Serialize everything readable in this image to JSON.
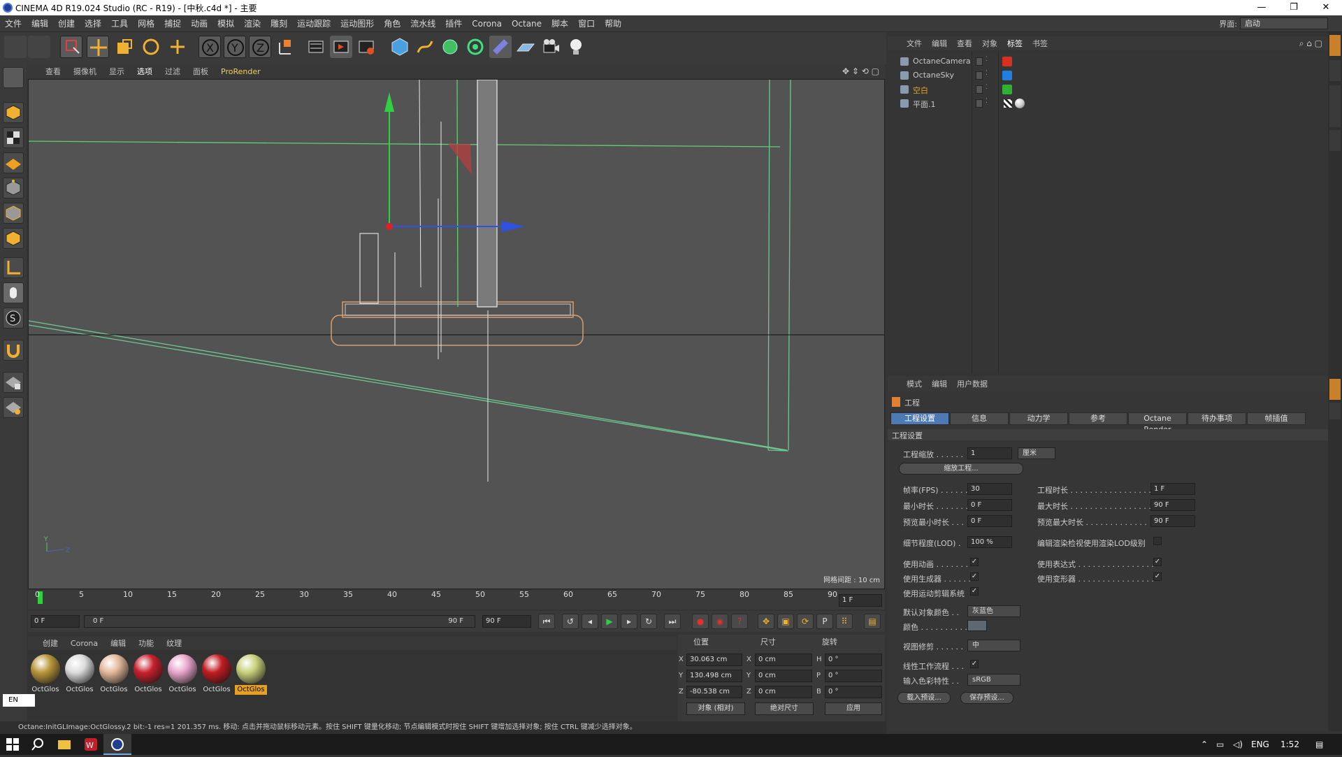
{
  "window": {
    "title": "CINEMA 4D R19.024 Studio (RC - R19) - [中秋.c4d *] - 主要"
  },
  "menu": [
    "文件",
    "编辑",
    "创建",
    "选择",
    "工具",
    "网格",
    "捕捉",
    "动画",
    "模拟",
    "渲染",
    "雕刻",
    "运动跟踪",
    "运动图形",
    "角色",
    "流水线",
    "插件",
    "Corona",
    "Octane",
    "脚本",
    "窗口",
    "帮助"
  ],
  "layout": {
    "label": "界面:",
    "value": "启动"
  },
  "viewport": {
    "menu": [
      "查看",
      "摄像机",
      "显示",
      "选项",
      "过滤",
      "面板",
      "ProRender"
    ],
    "grid_label": "网格间距 : 10 cm",
    "axis_y": "Y",
    "axis_z": "Z"
  },
  "timeline": {
    "ticks": [
      "0",
      "5",
      "10",
      "15",
      "20",
      "25",
      "30",
      "35",
      "40",
      "45",
      "50",
      "55",
      "60",
      "65",
      "70",
      "75",
      "80",
      "85",
      "90"
    ],
    "current_frame": "1 F",
    "start_field": "0 F",
    "range_start": "0 F",
    "range_end": "90 F",
    "end_field": "90 F"
  },
  "materials": {
    "menu": [
      "创建",
      "Corona",
      "编辑",
      "功能",
      "纹理"
    ],
    "items": [
      {
        "label": "OctGlos",
        "color": "#b8963a"
      },
      {
        "label": "OctGlos",
        "color": "#dcdcdc"
      },
      {
        "label": "OctGlos",
        "color": "#e2b89a"
      },
      {
        "label": "OctGlos",
        "color": "#c8202e"
      },
      {
        "label": "OctGlos",
        "color": "#e8a6cc"
      },
      {
        "label": "OctGlos",
        "color": "#c01c22"
      },
      {
        "label": "OctGlos",
        "color": "#c8d07a",
        "selected": true
      }
    ]
  },
  "coords": {
    "headers": [
      "位置",
      "尺寸",
      "旋转"
    ],
    "rows": [
      {
        "axis": "X",
        "pos": "30.063 cm",
        "size_axis": "X",
        "size": "0 cm",
        "rot_axis": "H",
        "rot": "0 °"
      },
      {
        "axis": "Y",
        "pos": "130.498 cm",
        "size_axis": "Y",
        "size": "0 cm",
        "rot_axis": "P",
        "rot": "0 °"
      },
      {
        "axis": "Z",
        "pos": "-80.538 cm",
        "size_axis": "Z",
        "size": "0 cm",
        "rot_axis": "B",
        "rot": "0 °"
      }
    ],
    "mode": "对象 (相对)",
    "size_mode": "绝对尺寸",
    "apply": "应用"
  },
  "status": "Octane:InitGLImage:OctGlossy.2  bit:-1 res=1  201.357 ms.      移动: 点击并拖动鼠标移动元素。按住 SHIFT 键量化移动; 节点编辑模式时按住 SHIFT 键增加选择对象; 按住 CTRL 键减少选择对象。",
  "lang": "EN",
  "object_manager": {
    "menu": [
      "文件",
      "编辑",
      "查看",
      "对象",
      "标签",
      "书签"
    ],
    "objects": [
      {
        "name": "OctaneCamera",
        "color": "#c8c8c8"
      },
      {
        "name": "OctaneSky",
        "color": "#c8c8c8"
      },
      {
        "name": "空白",
        "color": "#e8a020"
      },
      {
        "name": "平面.1",
        "color": "#c8c8c8"
      }
    ]
  },
  "attributes": {
    "menu": [
      "模式",
      "编辑",
      "用户数据"
    ],
    "title": "工程",
    "tabs": [
      "工程设置",
      "信息",
      "动力学",
      "参考",
      "Octane Render",
      "待办事项",
      "帧插值"
    ],
    "section": "工程设置",
    "scale_label": "工程缩放 . . . . . .",
    "scale_value": "1",
    "scale_unit": "厘米",
    "scale_btn": "缩放工程...",
    "fps_label": "帧率(FPS) . . . . . .",
    "fps": "30",
    "min_label": "最小时长 . . . . . . .",
    "min": "0 F",
    "pmin_label": "预览最小时长 . . .",
    "pmin": "0 F",
    "dur_label": "工程时长 . . . . . . . . . . . . . . . . .",
    "dur": "1 F",
    "max_label": "最大时长 . . . . . . . . . . . . . . . . .",
    "max": "90 F",
    "pmax_label": "预览最大时长 . . . . . . . . . . . . .",
    "pmax": "90 F",
    "lod_label": "细节程度(LOD) .",
    "lod": "100 %",
    "lod_render_label": "编辑渲染检视使用渲染LOD级别",
    "anim_label": "使用动画 . . . . . . .",
    "gen_label": "使用生成器 . . . . . .",
    "motion_label": "使用运动剪辑系统",
    "expr_label": "使用表达式 . . . . . . . . . . . . . . . .",
    "deform_label": "使用变形器 . . . . . . . . . . . . . . . .",
    "color_label": "默认对象颜色 . .",
    "color_value": "灰蓝色",
    "color2_label": "颜色 . . . . . . . . . .",
    "clip_label": "视图修剪 . . . . . .",
    "clip_value": "中",
    "linear_label": "线性工作流程 . . .",
    "input_label": "输入色彩特性 . .",
    "input_value": "sRGB",
    "load_btn": "载入预设...",
    "save_btn": "保存预设..."
  },
  "taskbar": {
    "lang": "ENG",
    "time": "1:52"
  }
}
